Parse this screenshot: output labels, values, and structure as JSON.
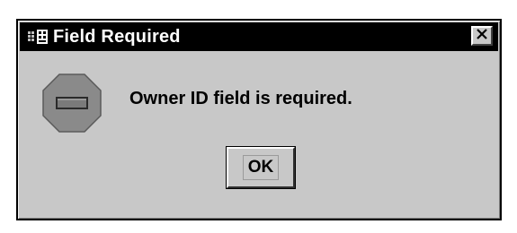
{
  "window": {
    "title": "Field Required",
    "title_icon": "app-window-icon",
    "close_icon": "close-icon"
  },
  "body": {
    "icon": "stop-sign-icon",
    "message": "Owner ID field is required."
  },
  "buttons": {
    "ok_label": "OK"
  },
  "colors": {
    "titlebar": "#000000",
    "dialog_bg": "#c8c8c8",
    "title_text": "#ffffff",
    "stop_sign": "#8a8a8a"
  }
}
